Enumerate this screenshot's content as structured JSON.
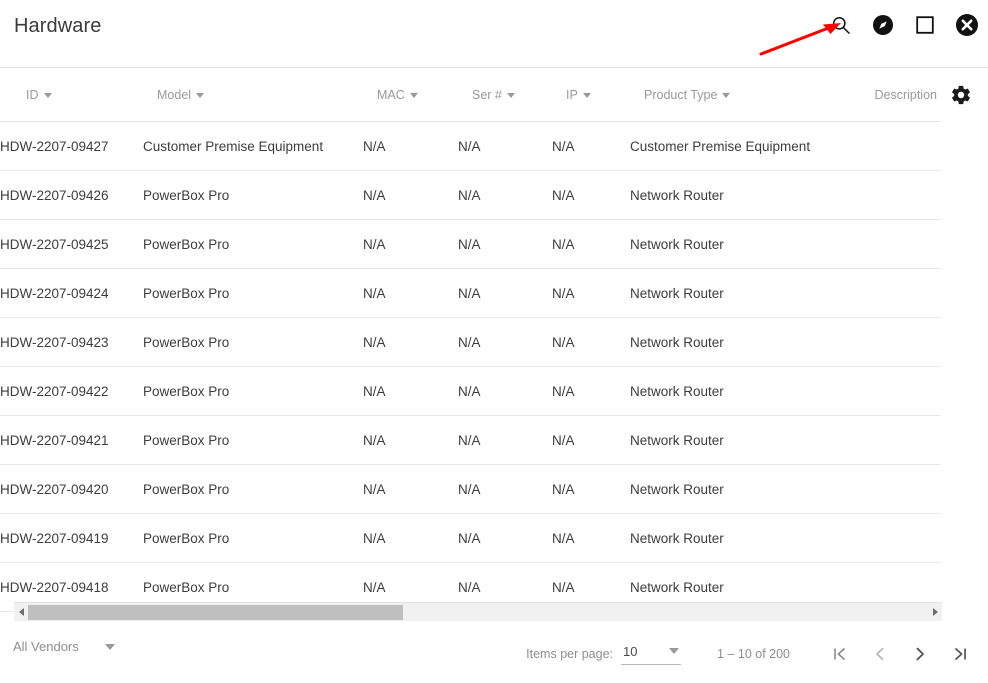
{
  "header": {
    "title": "Hardware",
    "actions": [
      {
        "name": "search-icon",
        "label": "Search"
      },
      {
        "name": "compass-icon",
        "label": "Navigate"
      },
      {
        "name": "maximize-icon",
        "label": "Maximize"
      },
      {
        "name": "close-icon",
        "label": "Close"
      }
    ]
  },
  "annotation": {
    "type": "arrow",
    "color": "#ff0000",
    "points_to": "search-icon"
  },
  "table": {
    "columns": [
      {
        "key": "id",
        "label": "ID",
        "sortable": true
      },
      {
        "key": "model",
        "label": "Model",
        "sortable": true
      },
      {
        "key": "mac",
        "label": "MAC",
        "sortable": true
      },
      {
        "key": "ser",
        "label": "Ser #",
        "sortable": true
      },
      {
        "key": "ip",
        "label": "IP",
        "sortable": true
      },
      {
        "key": "product_type",
        "label": "Product Type",
        "sortable": true
      },
      {
        "key": "description",
        "label": "Description",
        "sortable": false
      }
    ],
    "settings_icon": "gear-icon",
    "rows": [
      {
        "id": "HDW-2207-09427",
        "model": "Customer Premise Equipment",
        "mac": "N/A",
        "ser": "N/A",
        "ip": "N/A",
        "product_type": "Customer Premise Equipment",
        "description": ""
      },
      {
        "id": "HDW-2207-09426",
        "model": "PowerBox Pro",
        "mac": "N/A",
        "ser": "N/A",
        "ip": "N/A",
        "product_type": "Network Router",
        "description": ""
      },
      {
        "id": "HDW-2207-09425",
        "model": "PowerBox Pro",
        "mac": "N/A",
        "ser": "N/A",
        "ip": "N/A",
        "product_type": "Network Router",
        "description": ""
      },
      {
        "id": "HDW-2207-09424",
        "model": "PowerBox Pro",
        "mac": "N/A",
        "ser": "N/A",
        "ip": "N/A",
        "product_type": "Network Router",
        "description": ""
      },
      {
        "id": "HDW-2207-09423",
        "model": "PowerBox Pro",
        "mac": "N/A",
        "ser": "N/A",
        "ip": "N/A",
        "product_type": "Network Router",
        "description": ""
      },
      {
        "id": "HDW-2207-09422",
        "model": "PowerBox Pro",
        "mac": "N/A",
        "ser": "N/A",
        "ip": "N/A",
        "product_type": "Network Router",
        "description": ""
      },
      {
        "id": "HDW-2207-09421",
        "model": "PowerBox Pro",
        "mac": "N/A",
        "ser": "N/A",
        "ip": "N/A",
        "product_type": "Network Router",
        "description": ""
      },
      {
        "id": "HDW-2207-09420",
        "model": "PowerBox Pro",
        "mac": "N/A",
        "ser": "N/A",
        "ip": "N/A",
        "product_type": "Network Router",
        "description": ""
      },
      {
        "id": "HDW-2207-09419",
        "model": "PowerBox Pro",
        "mac": "N/A",
        "ser": "N/A",
        "ip": "N/A",
        "product_type": "Network Router",
        "description": ""
      },
      {
        "id": "HDW-2207-09418",
        "model": "PowerBox Pro",
        "mac": "N/A",
        "ser": "N/A",
        "ip": "N/A",
        "product_type": "Network Router",
        "description": ""
      }
    ]
  },
  "footer": {
    "vendor_filter": {
      "value": "All Vendors"
    },
    "paginator": {
      "items_per_page_label": "Items per page:",
      "items_per_page_value": "10",
      "range_label": "1 – 10 of 200",
      "buttons": [
        {
          "name": "first-page-button",
          "glyph": "|<"
        },
        {
          "name": "prev-page-button",
          "glyph": "<"
        },
        {
          "name": "next-page-button",
          "glyph": ">"
        },
        {
          "name": "last-page-button",
          "glyph": ">|"
        }
      ]
    }
  },
  "colors": {
    "header_text": "#3b3b3b",
    "muted_text": "#9a9a9a",
    "body_text": "#3d3d3d",
    "divider": "#e4e4e4",
    "annotation_red": "#ff0000",
    "scroll_thumb": "#bfbfbf"
  }
}
